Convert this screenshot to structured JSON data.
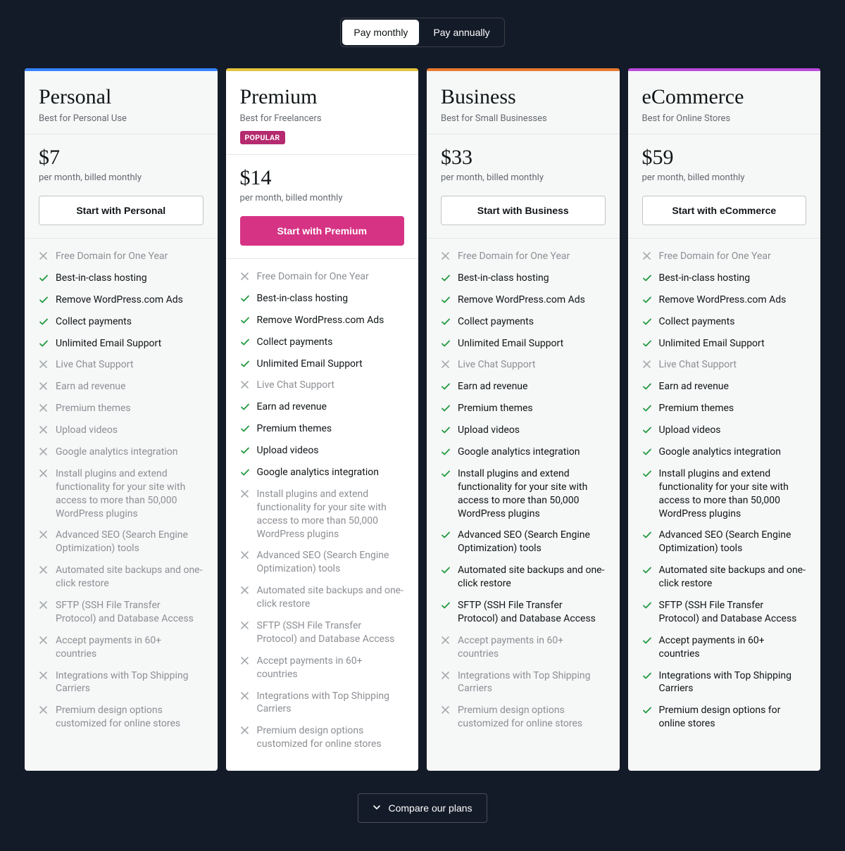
{
  "toggle": {
    "monthly": "Pay monthly",
    "annually": "Pay annually"
  },
  "compare_button": "Compare our plans",
  "feature_labels": [
    "Free Domain for One Year",
    "Best-in-class hosting",
    "Remove WordPress.com Ads",
    "Collect payments",
    "Unlimited Email Support",
    "Live Chat Support",
    "Earn ad revenue",
    "Premium themes",
    "Upload videos",
    "Google analytics integration",
    "Install plugins and extend functionality for your site with access to more than 50,000 WordPress plugins",
    "Advanced SEO (Search Engine Optimization) tools",
    "Automated site backups and one-click restore",
    "SFTP (SSH File Transfer Protocol) and Database Access",
    "Accept payments in 60+ countries",
    "Integrations with Top Shipping Carriers",
    "Premium design options customized for online stores"
  ],
  "ecommerce_design_label": "Premium design options for online stores",
  "plans": [
    {
      "id": "personal",
      "title": "Personal",
      "tagline": "Best for Personal Use",
      "badge": "",
      "price": "$7",
      "price_sub": "per month, billed monthly",
      "cta": "Start with Personal",
      "accent": "#3582ff",
      "highlight": false,
      "included": [
        false,
        true,
        true,
        true,
        true,
        false,
        false,
        false,
        false,
        false,
        false,
        false,
        false,
        false,
        false,
        false,
        false
      ]
    },
    {
      "id": "premium",
      "title": "Premium",
      "tagline": "Best for Freelancers",
      "badge": "POPULAR",
      "price": "$14",
      "price_sub": "per month, billed monthly",
      "cta": "Start with Premium",
      "accent": "#e3c23c",
      "highlight": true,
      "included": [
        false,
        true,
        true,
        true,
        true,
        false,
        true,
        true,
        true,
        true,
        false,
        false,
        false,
        false,
        false,
        false,
        false
      ]
    },
    {
      "id": "business",
      "title": "Business",
      "tagline": "Best for Small Businesses",
      "badge": "",
      "price": "$33",
      "price_sub": "per month, billed monthly",
      "cta": "Start with Business",
      "accent": "#e97b2e",
      "highlight": false,
      "included": [
        false,
        true,
        true,
        true,
        true,
        false,
        true,
        true,
        true,
        true,
        true,
        true,
        true,
        true,
        false,
        false,
        false
      ]
    },
    {
      "id": "ecommerce",
      "title": "eCommerce",
      "tagline": "Best for Online Stores",
      "badge": "",
      "price": "$59",
      "price_sub": "per month, billed monthly",
      "cta": "Start with eCommerce",
      "accent": "#b94adb",
      "highlight": false,
      "included": [
        false,
        true,
        true,
        true,
        true,
        false,
        true,
        true,
        true,
        true,
        true,
        true,
        true,
        true,
        true,
        true,
        true
      ]
    }
  ]
}
